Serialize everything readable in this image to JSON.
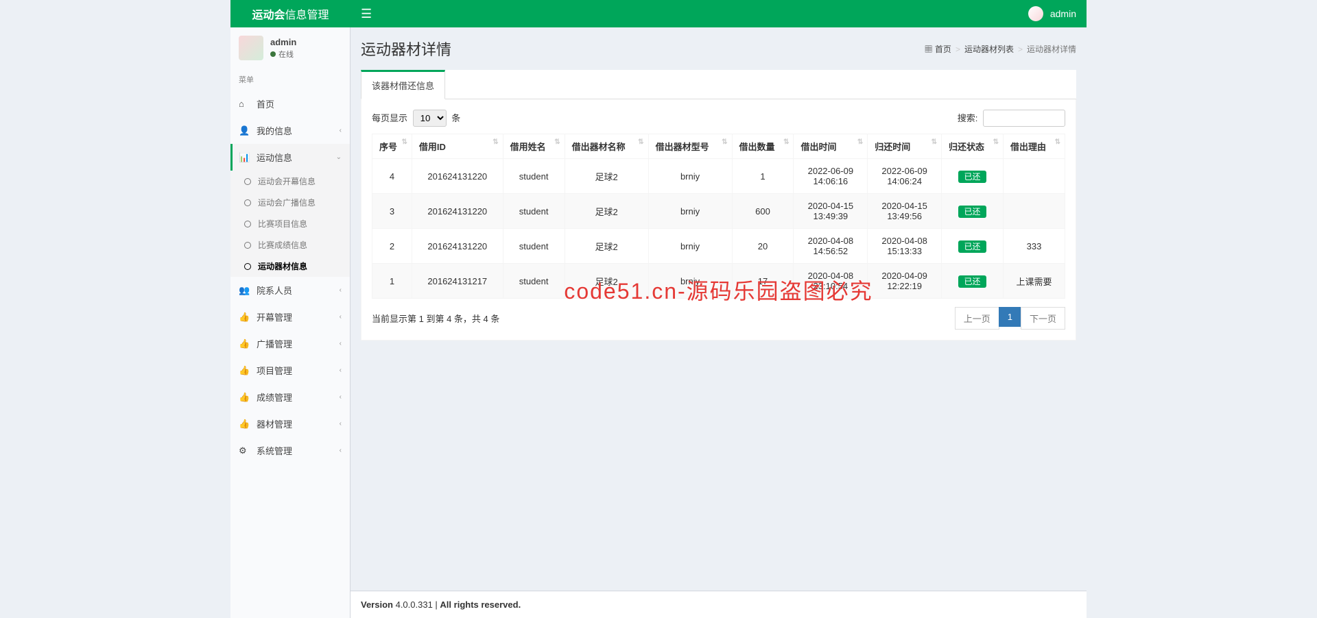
{
  "header": {
    "logo_bold": "运动会",
    "logo_light": "信息管理",
    "username": "admin"
  },
  "sidebar": {
    "user_name": "admin",
    "user_status": "在线",
    "menu_header": "菜单",
    "items": [
      {
        "icon": "home",
        "label": "首页",
        "expandable": false
      },
      {
        "icon": "user",
        "label": "我的信息",
        "expandable": true
      },
      {
        "icon": "chart",
        "label": "运动信息",
        "expandable": true,
        "open": true,
        "children": [
          {
            "label": "运动会开幕信息"
          },
          {
            "label": "运动会广播信息"
          },
          {
            "label": "比赛项目信息"
          },
          {
            "label": "比赛成绩信息"
          },
          {
            "label": "运动器材信息",
            "active": true
          }
        ]
      },
      {
        "icon": "users",
        "label": "院系人员",
        "expandable": true
      },
      {
        "icon": "thumbs",
        "label": "开幕管理",
        "expandable": true
      },
      {
        "icon": "thumbs",
        "label": "广播管理",
        "expandable": true
      },
      {
        "icon": "thumbs",
        "label": "项目管理",
        "expandable": true
      },
      {
        "icon": "thumbs",
        "label": "成绩管理",
        "expandable": true
      },
      {
        "icon": "thumbs",
        "label": "器材管理",
        "expandable": true
      },
      {
        "icon": "gear",
        "label": "系统管理",
        "expandable": true
      }
    ]
  },
  "page": {
    "title": "运动器材详情",
    "breadcrumb": [
      {
        "label": "首页",
        "icon": true
      },
      {
        "label": "运动器材列表"
      },
      {
        "label": "运动器材详情",
        "active": true
      }
    ],
    "tab_label": "该器材借还信息"
  },
  "table": {
    "length_prefix": "每页显示",
    "length_value": "10",
    "length_suffix": "条",
    "search_label": "搜索:",
    "search_value": "",
    "columns": [
      "序号",
      "借用ID",
      "借用姓名",
      "借出器材名称",
      "借出器材型号",
      "借出数量",
      "借出时间",
      "归还时间",
      "归还状态",
      "借出理由"
    ],
    "rows": [
      {
        "seq": "4",
        "id": "201624131220",
        "name": "student",
        "equip": "足球2",
        "model": "brniy",
        "qty": "1",
        "out": "2022-06-09 14:06:16",
        "ret": "2022-06-09 14:06:24",
        "status": "已还",
        "reason": ""
      },
      {
        "seq": "3",
        "id": "201624131220",
        "name": "student",
        "equip": "足球2",
        "model": "brniy",
        "qty": "600",
        "out": "2020-04-15 13:49:39",
        "ret": "2020-04-15 13:49:56",
        "status": "已还",
        "reason": ""
      },
      {
        "seq": "2",
        "id": "201624131220",
        "name": "student",
        "equip": "足球2",
        "model": "brniy",
        "qty": "20",
        "out": "2020-04-08 14:56:52",
        "ret": "2020-04-08 15:13:33",
        "status": "已还",
        "reason": "333"
      },
      {
        "seq": "1",
        "id": "201624131217",
        "name": "student",
        "equip": "足球2",
        "model": "brniy",
        "qty": "17",
        "out": "2020-04-08 23:10:54",
        "ret": "2020-04-09 12:22:19",
        "status": "已还",
        "reason": "上课需要"
      }
    ],
    "info": "当前显示第 1 到第 4 条，共 4 条",
    "prev": "上一页",
    "page": "1",
    "next": "下一页"
  },
  "footer": {
    "version_label": "Version",
    "version": "4.0.0.331",
    "rights": "All rights reserved."
  },
  "watermark": "code51.cn-源码乐园盗图必究",
  "icons": {
    "home": "⌂",
    "user": "👤",
    "chart": "📊",
    "users": "👥",
    "thumbs": "👍",
    "gear": "⚙",
    "dash": "▦",
    "bars": "☰",
    "down": "⌄",
    "left": "‹",
    "sort": "⇅"
  }
}
